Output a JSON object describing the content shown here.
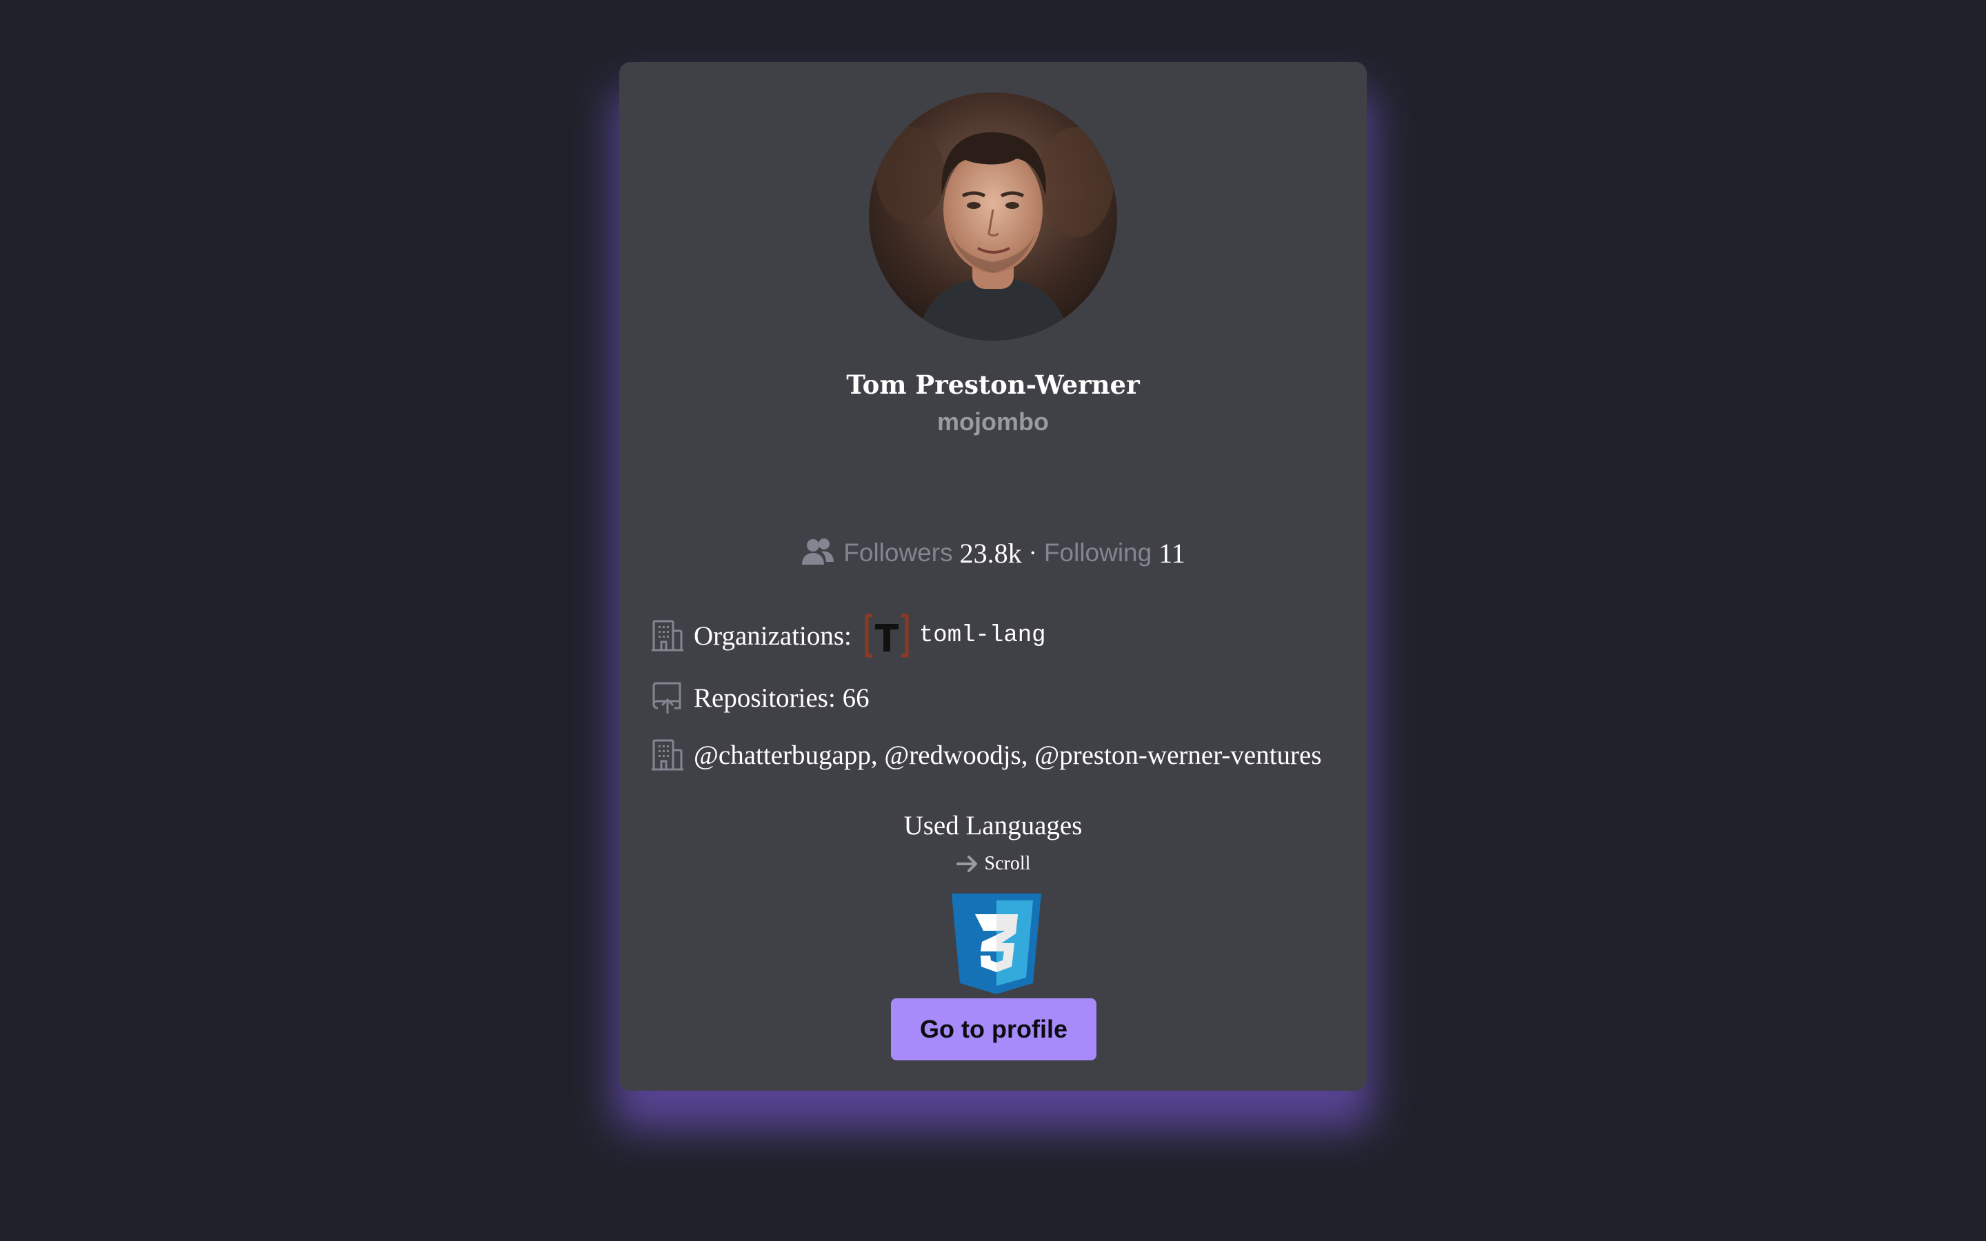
{
  "profile": {
    "name": "Tom Preston-Werner",
    "login": "mojombo",
    "avatar_icon": "user-avatar-photo"
  },
  "stats": {
    "icon": "users-icon",
    "followers_label": "Followers",
    "followers_count": "23.8k",
    "separator": "·",
    "following_label": "Following",
    "following_count": "11"
  },
  "details": {
    "organizations_label": "Organizations:",
    "organizations_icon": "building-icon",
    "organizations": [
      {
        "name": "toml-lang",
        "logo_icon": "toml-logo"
      }
    ],
    "repositories_label": "Repositories: 66",
    "repositories_icon": "repo-icon",
    "company": "@chatterbugapp, @redwoodjs, @preston-werner-ventures",
    "company_icon": "building-icon"
  },
  "languages": {
    "title": "Used Languages",
    "scroll_label": "Scroll",
    "scroll_icon": "arrow-right-icon",
    "items": [
      {
        "name": "CSS3",
        "icon": "css3-icon"
      }
    ]
  },
  "actions": {
    "go_to_profile": "Go to profile"
  },
  "colors": {
    "page_background": "#1f222a",
    "card_background": "#404047",
    "card_glow": "#7c58d6",
    "button_background": "#a78bfa",
    "muted_text": "#858591",
    "login_text": "#9a9aa3"
  }
}
